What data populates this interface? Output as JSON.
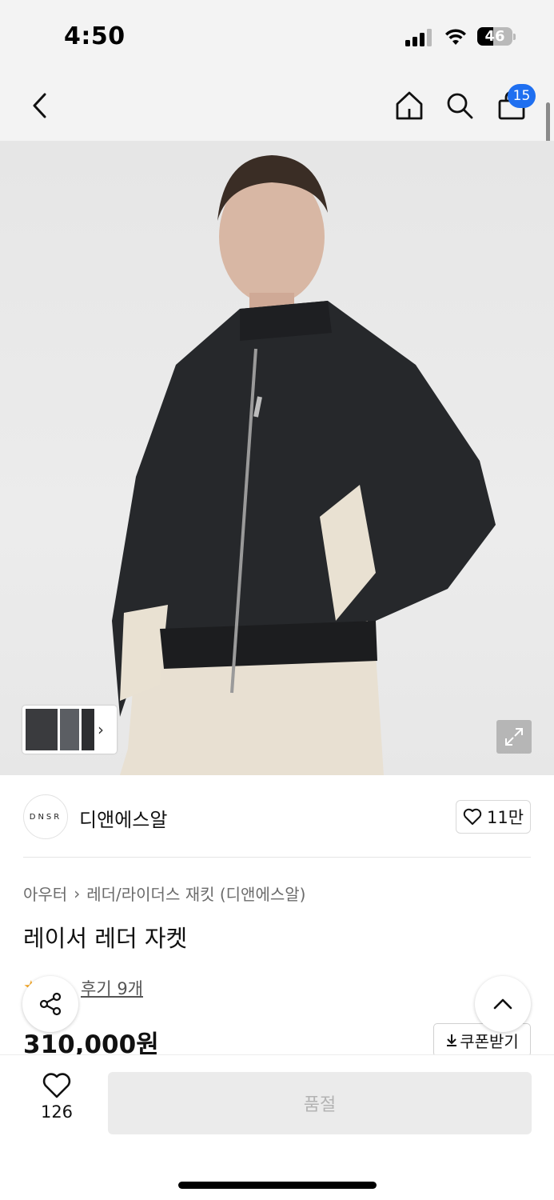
{
  "status_bar": {
    "time": "4:50",
    "battery": "46",
    "battery_level": 0.46
  },
  "header": {
    "cart_count": "15"
  },
  "brand": {
    "logo_text": "DNSR",
    "name": "디앤에스알",
    "likes": "11만"
  },
  "product": {
    "category": "아우터",
    "subcategory": "레더/라이더스 재킷 (디앤에스알)",
    "title": "레이서 레더 자켓",
    "rating": "",
    "reviews_label": "후기 9개",
    "price": "310,000원",
    "coupon_label": "쿠폰받기"
  },
  "bottom_bar": {
    "wish_count": "126",
    "buy_label": "품절"
  },
  "colors": {
    "accent": "#1f6ff0",
    "star": "#f5a623",
    "soldout_bg": "#ebebeb"
  }
}
